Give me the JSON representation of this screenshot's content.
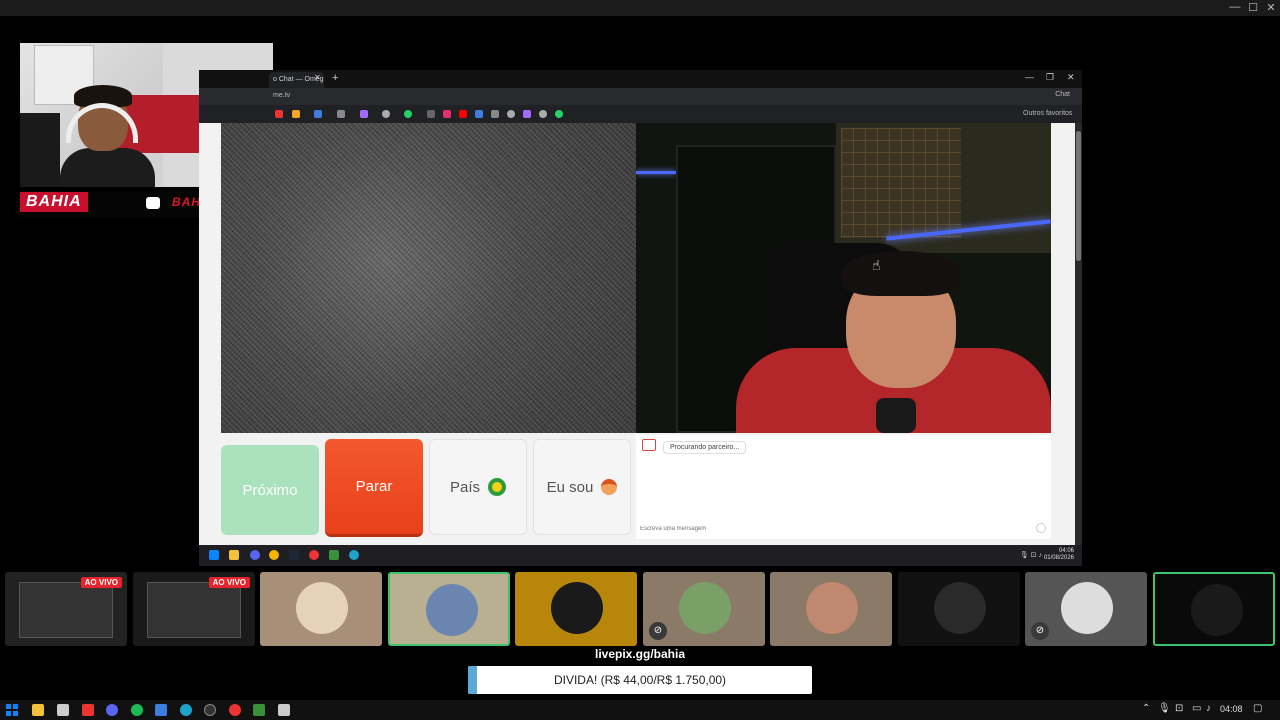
{
  "window": {
    "minimize": "—",
    "maximize": "☐",
    "close": "✕"
  },
  "webcam": {
    "brand_left": "BAHIA",
    "brand_right": "BAHIAFPSS"
  },
  "browser": {
    "tab_title": "o Chat — Omeg",
    "url": "me.tv",
    "other_bookmarks": "Outros favoritos",
    "profile_label": "Chat"
  },
  "page": {
    "buttons": {
      "next": "Próximo",
      "stop": "Parar",
      "country": "País",
      "i_am": "Eu sou"
    },
    "chat": {
      "status": "Procurando parceiro...",
      "placeholder": "Escreva uma mensagem"
    }
  },
  "inner_taskbar": {
    "time": "04:06",
    "date": "01/08/2026"
  },
  "participants": {
    "live_badge": "AO VIVO",
    "tiles": [
      {
        "type": "screen",
        "live": true,
        "color": "#222"
      },
      {
        "type": "screen",
        "live": true,
        "color": "#1a1a1a"
      },
      {
        "type": "avatar",
        "color": "#a89078",
        "avatar": "#e6d2b8"
      },
      {
        "type": "avatar",
        "color": "#b8b090",
        "avatar": "#6a86b0",
        "active": true
      },
      {
        "type": "avatar",
        "color": "#b8860b",
        "avatar": "#1a1a1a"
      },
      {
        "type": "avatar",
        "color": "#8c7a68",
        "avatar": "#7aa068",
        "muted": true
      },
      {
        "type": "avatar",
        "color": "#8c7a68",
        "avatar": "#c08870"
      },
      {
        "type": "avatar",
        "color": "#111",
        "avatar": "#2a2a2a"
      },
      {
        "type": "avatar",
        "color": "#555",
        "avatar": "#ddd",
        "muted": true
      },
      {
        "type": "avatar",
        "color": "#0a0a0a",
        "avatar": "#1a1a1a",
        "active": true
      }
    ]
  },
  "donation": {
    "link": "livepix.gg/bahia",
    "goal_text": "DIVIDA! (R$ 44,00/R$ 1.750,00)",
    "progress_fraction": 0.025
  },
  "host_taskbar": {
    "time": "04:08"
  }
}
